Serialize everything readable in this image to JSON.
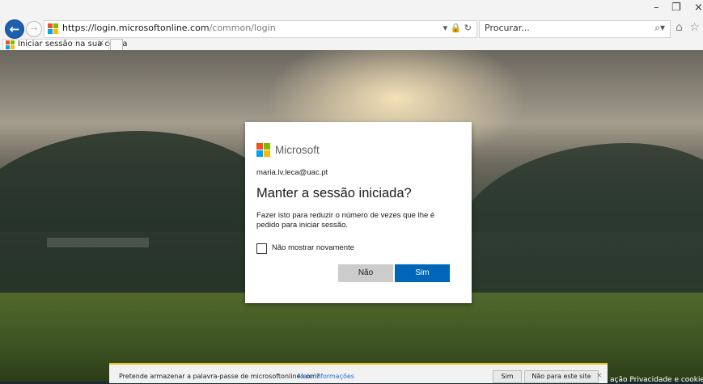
{
  "browser": {
    "address_host": "https://login.microsoftonline.com",
    "address_path": "/common/login",
    "search_placeholder": "Procurar...",
    "tab_title": "Iniciar sessão na sua conta",
    "tab_close": "×",
    "window_controls": [
      "–",
      "❐",
      "×"
    ],
    "back_glyph": "←",
    "forward_glyph": "→",
    "addr_icons": "▾ 🔒 ↻",
    "search_icon": "⌕▾",
    "tool_icons": "⌂ ☆ ⚙"
  },
  "dialog": {
    "brand": "Microsoft",
    "email": "maria.lv.leca@uac.pt",
    "title": "Manter a sessão iniciada?",
    "description": "Fazer isto para reduzir o número de vezes que lhe é pedido para iniciar sessão.",
    "checkbox_label": "Não mostrar novamente",
    "no_label": "Não",
    "yes_label": "Sim",
    "logo_colors": [
      "#f25022",
      "#7fba00",
      "#00a4ef",
      "#ffb900"
    ]
  },
  "footer": {
    "links": "ação   Privacidade e cookies"
  },
  "notification": {
    "text": "Pretende armazenar a palavra-passe de microsoftonline.com?",
    "link": "Mais informações",
    "yes_label": "Sim",
    "no_label": "Não para este site",
    "close": "×"
  }
}
